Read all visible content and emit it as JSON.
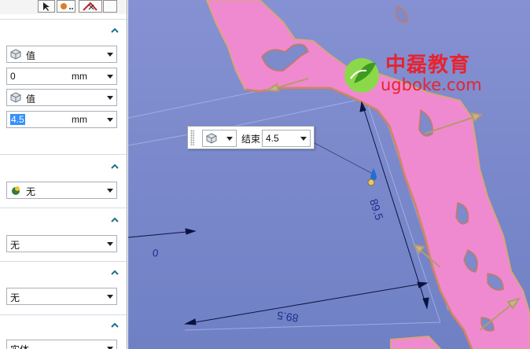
{
  "toolbar": {
    "btn1_icon": "select-arrow-icon",
    "btn2_icon": "quick-pick-icon",
    "btn3_icon": "snap-point-icon"
  },
  "section1": {
    "start_option": "值",
    "start_value": "0",
    "start_unit": "mm",
    "end_option": "值",
    "end_value": "4.5",
    "end_unit": "mm"
  },
  "section2": {
    "boolean_option": "无"
  },
  "section3": {
    "option": "无"
  },
  "section4": {
    "option": "无"
  },
  "section5": {
    "option": "实体"
  },
  "widget": {
    "end_label": "结束",
    "end_value": "4.5"
  },
  "dimensions": {
    "vertical": "89.5",
    "horizontal": "89.5",
    "small": "0"
  },
  "watermark": {
    "cn": "中磊教育",
    "en": "ugboke.com"
  },
  "colors": {
    "part": "#f08ad0",
    "part_edge": "#d9a57a",
    "viewport_top": "#8591d2",
    "viewport_bottom": "#6f80c4",
    "accent": "#1d6f8e"
  }
}
